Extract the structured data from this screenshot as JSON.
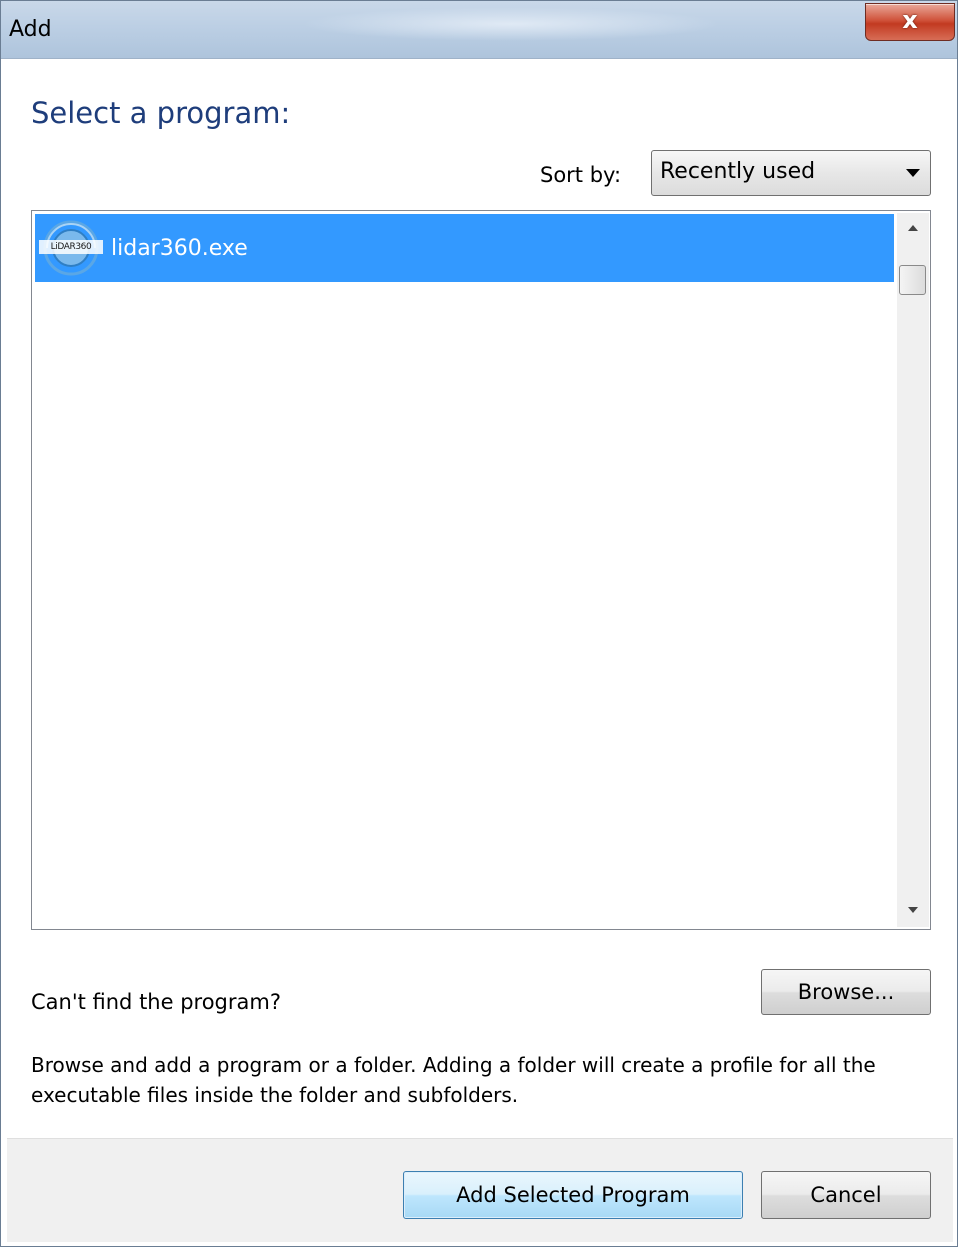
{
  "window": {
    "title": "Add",
    "close_symbol": "x"
  },
  "main": {
    "heading": "Select a program:",
    "sort_label": "Sort by:",
    "sort_value": "Recently used",
    "programs": [
      {
        "label": "lidar360.exe",
        "icon_text": "LiDAR360",
        "selected": true
      }
    ],
    "cant_find": "Can't find the program?",
    "browse_label": "Browse...",
    "description": "Browse and add a program or a folder. Adding a folder will create a profile for all the executable files inside the folder and subfolders."
  },
  "footer": {
    "add_label": "Add Selected Program",
    "cancel_label": "Cancel"
  },
  "colors": {
    "selection": "#3399ff",
    "heading": "#1e3d7b",
    "close_button": "#c23a21"
  }
}
